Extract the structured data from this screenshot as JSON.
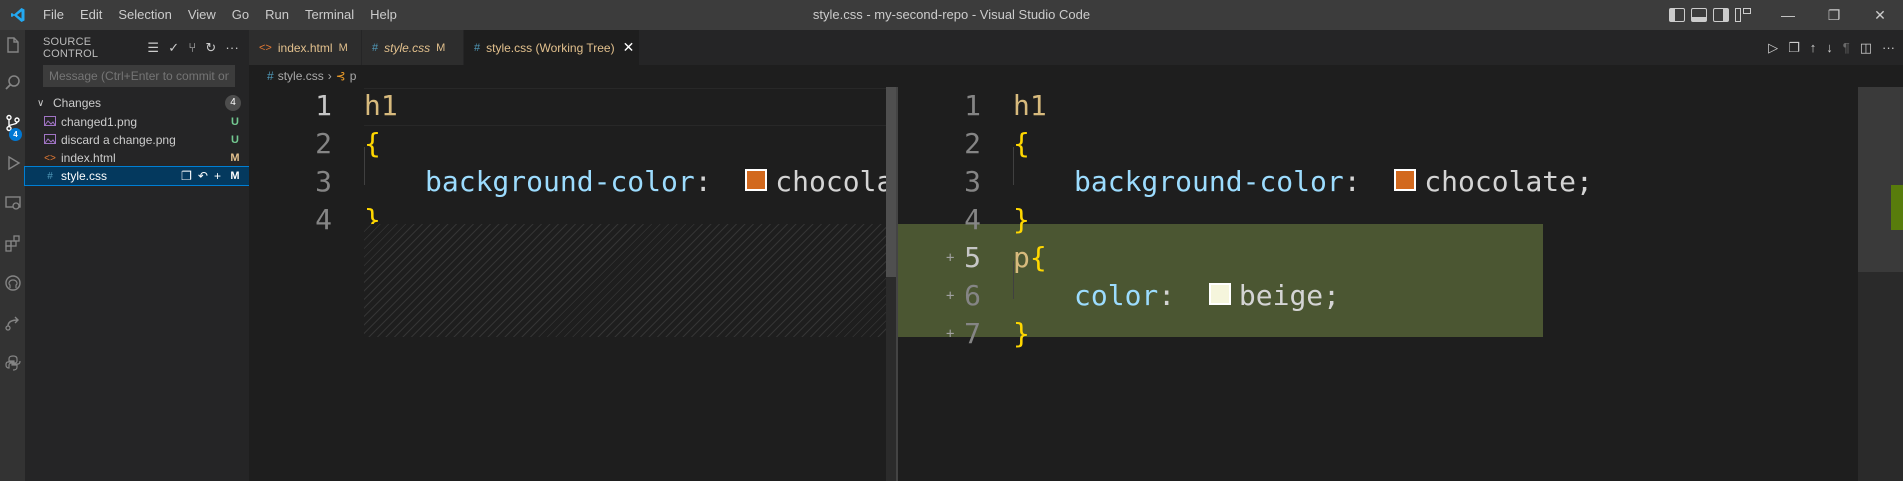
{
  "titlebar": {
    "window_title": "style.css - my-second-repo - Visual Studio Code",
    "menu": [
      "File",
      "Edit",
      "Selection",
      "View",
      "Go",
      "Run",
      "Terminal",
      "Help"
    ],
    "minimize": "—",
    "restore": "❐",
    "close": "✕"
  },
  "activitybar": {
    "scm_badge": "4"
  },
  "sidebar": {
    "title": "SOURCE CONTROL",
    "commit_placeholder": "Message (Ctrl+Enter to commit on 'm...",
    "changes_label": "Changes",
    "changes_count": "4",
    "files": [
      {
        "name": "changed1.png",
        "status": "U",
        "icon": "image-icon"
      },
      {
        "name": "discard a change.png",
        "status": "U",
        "icon": "image-icon"
      },
      {
        "name": "index.html",
        "status": "M",
        "icon": "html-icon"
      },
      {
        "name": "style.css",
        "status": "M",
        "icon": "css-icon"
      }
    ]
  },
  "tabs": [
    {
      "label": "index.html",
      "status": "M",
      "icon": "<>"
    },
    {
      "label": "style.css",
      "status": "M",
      "icon": "#"
    },
    {
      "label": "style.css (Working Tree)",
      "status": "",
      "icon": "#"
    }
  ],
  "breadcrumb": {
    "file": "style.css",
    "symbol": "p"
  },
  "editor_left": {
    "lines": [
      {
        "n": "1"
      },
      {
        "n": "2"
      },
      {
        "n": "3"
      },
      {
        "n": "4"
      }
    ],
    "tokens": {
      "selector": "h1",
      "open_brace": "{",
      "property": "background-color",
      "colon": ":",
      "value": "chocolate",
      "semi": ";",
      "close_brace": "}"
    }
  },
  "editor_right": {
    "lines": [
      {
        "n": "1"
      },
      {
        "n": "2"
      },
      {
        "n": "3"
      },
      {
        "n": "4"
      },
      {
        "n": "5"
      },
      {
        "n": "6"
      },
      {
        "n": "7"
      }
    ],
    "plus": "+",
    "tokens": {
      "selector": "h1",
      "open_brace": "{",
      "property": "background-color",
      "colon": ":",
      "value": "chocolate",
      "semi": ";",
      "close_brace": "}",
      "selector2": "p",
      "open_brace2": "{",
      "property2": "color",
      "colon2": ":",
      "value2": "beige",
      "semi2": ";",
      "close_brace2": "}"
    }
  },
  "colors": {
    "chocolate": "#d2691e",
    "beige": "#f5f5dc",
    "added_line": "#4b5632",
    "accent": "#0078d4"
  }
}
